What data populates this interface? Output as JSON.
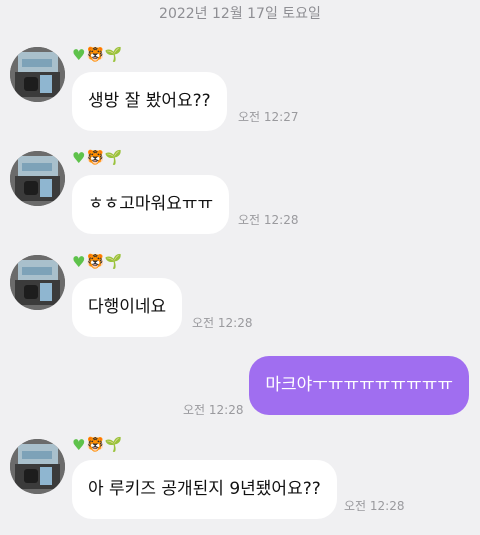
{
  "date_header": "2022년 12월 17일 토요일",
  "sender": {
    "name_icons": [
      "green-heart-icon",
      "tiger-icon",
      "sprout-icon"
    ]
  },
  "messages": [
    {
      "direction": "in",
      "text": "생방 잘 봤어요??",
      "time": "오전 12:27"
    },
    {
      "direction": "in",
      "text": "ㅎㅎ고마워요ㅠㅠ",
      "time": "오전 12:28"
    },
    {
      "direction": "in",
      "text": "다행이네요",
      "time": "오전 12:28"
    },
    {
      "direction": "out",
      "text": "마크야ㅜㅠㅠㅠㅠㅠㅠㅠㅠ",
      "time": "오전 12:28"
    },
    {
      "direction": "in",
      "text": "아 루키즈 공개된지 9년됐어요??",
      "time": "오전 12:28"
    }
  ],
  "colors": {
    "background": "#f0f0f2",
    "incoming_bubble": "#ffffff",
    "outgoing_bubble": "#a06ef0",
    "time_text": "#9a9a9e"
  }
}
